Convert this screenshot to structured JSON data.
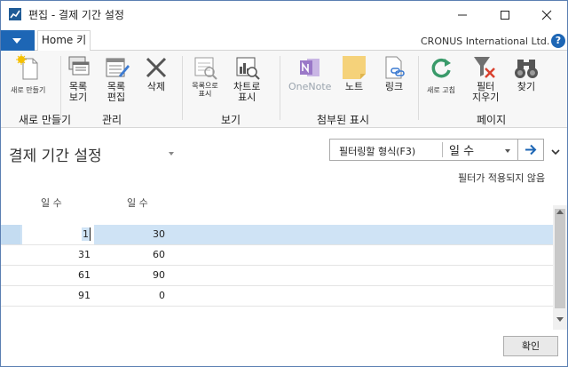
{
  "window": {
    "title": "편집 - 결제 기간 설정",
    "min_glyph": "—",
    "max_glyph": "☐",
    "close_glyph": "✕"
  },
  "ribbon_tabs": {
    "file_icon": "dropdown-arrow-icon",
    "home_label": "Home 키",
    "company": "CRONUS International Ltd.",
    "help_label": "?"
  },
  "ribbon": {
    "buttons": [
      {
        "label": "새로 만들기",
        "icon": "new-document-icon"
      },
      {
        "label": "목록\n보기",
        "icon": "list-view-icon"
      },
      {
        "label": "목록\n편집",
        "icon": "list-edit-icon"
      },
      {
        "label": "삭제",
        "icon": "delete-icon"
      },
      {
        "label": "목록으로\n표시",
        "icon": "show-as-list-icon"
      },
      {
        "label": "차트로\n표시",
        "icon": "show-as-chart-icon"
      },
      {
        "label": "OneNote",
        "icon": "onenote-icon"
      },
      {
        "label": "노트",
        "icon": "note-icon"
      },
      {
        "label": "링크",
        "icon": "link-icon"
      },
      {
        "label": "새로 고침",
        "icon": "refresh-icon"
      },
      {
        "label": "필터\n지우기",
        "icon": "clear-filter-icon"
      },
      {
        "label": "찾기",
        "icon": "find-icon"
      }
    ],
    "groups": [
      "새로 만들기",
      "관리",
      "보기",
      "첨부된 표시",
      "페이지"
    ]
  },
  "page": {
    "title": "결제 기간 설정",
    "filter_label": "필터링할 형식(F3)",
    "filter_field": "일 수",
    "no_filter_text": "필터가 적용되지 않음"
  },
  "table": {
    "columns": [
      "일 수",
      "일 수"
    ],
    "rows": [
      {
        "c1": "1",
        "c2": "30",
        "selected": true
      },
      {
        "c1": "31",
        "c2": "60",
        "selected": false
      },
      {
        "c1": "61",
        "c2": "90",
        "selected": false
      },
      {
        "c1": "91",
        "c2": "0",
        "selected": false
      }
    ]
  },
  "footer": {
    "ok_label": "확인"
  },
  "colors": {
    "accent": "#1d66b5",
    "selection": "#cfe3f5"
  }
}
